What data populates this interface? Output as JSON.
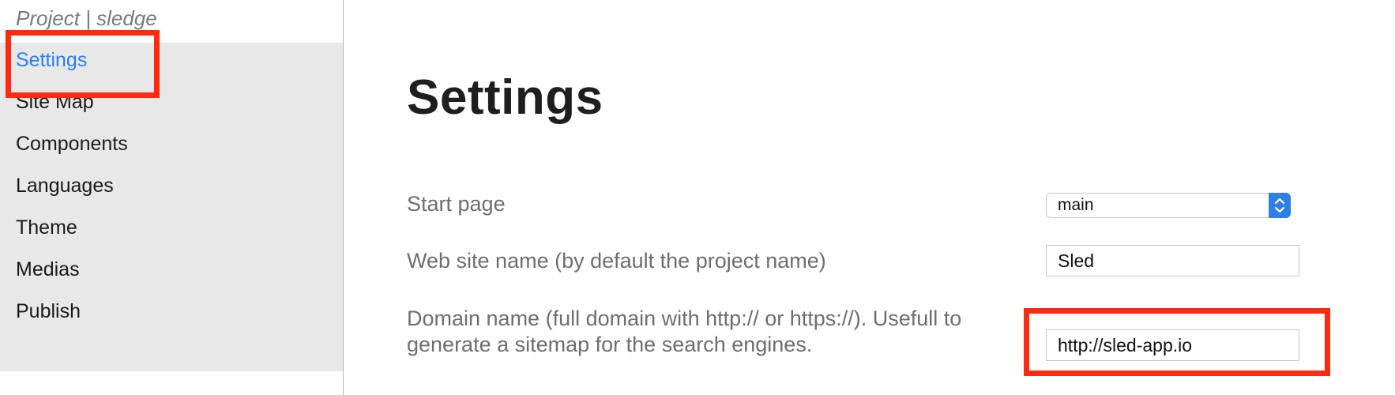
{
  "sidebar": {
    "project_title": "Project | sledge",
    "items": [
      {
        "label": "Settings",
        "active": true
      },
      {
        "label": "Site Map",
        "active": false
      },
      {
        "label": "Components",
        "active": false
      },
      {
        "label": "Languages",
        "active": false
      },
      {
        "label": "Theme",
        "active": false
      },
      {
        "label": "Medias",
        "active": false
      },
      {
        "label": "Publish",
        "active": false
      }
    ]
  },
  "main": {
    "title": "Settings",
    "fields": {
      "start_page": {
        "label": "Start page",
        "value": "main"
      },
      "site_name": {
        "label": "Web site name (by default the project name)",
        "value": "Sled"
      },
      "domain": {
        "label_line1": "Domain name (full domain with http:// or https://). Usefull to",
        "label_line2": "generate a sitemap for the search engines.",
        "value": "http://sled-app.io"
      }
    }
  },
  "colors": {
    "accent": "#2d7ff0",
    "annotation": "#ff2a12",
    "sidebar_bg": "#e8e8e8"
  },
  "icons": {
    "select_arrows": "chevron-up-down-icon"
  }
}
